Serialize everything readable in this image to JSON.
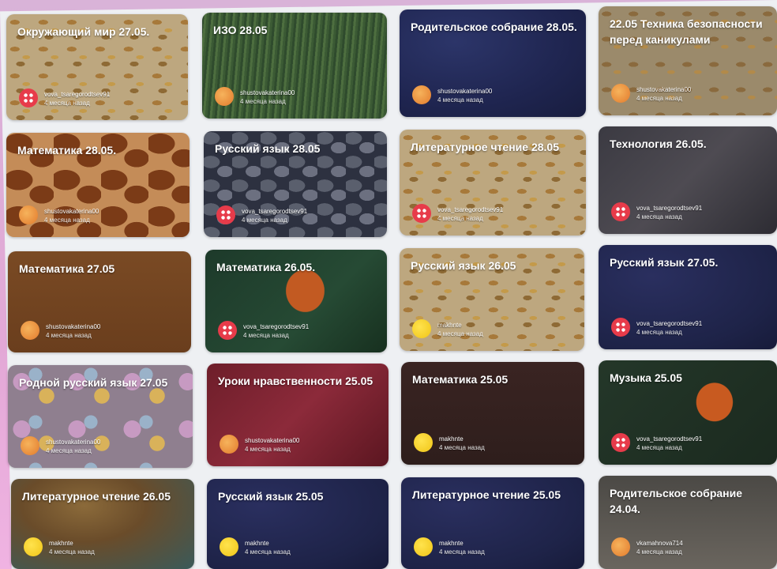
{
  "cards": [
    {
      "title": "Окружающий мир 27.05.",
      "user": "vova_tsaregorodtsev91",
      "time": "4 месяца назад",
      "avatar": "red"
    },
    {
      "title": "ИЗО 28.05",
      "user": "shustovakaterina00",
      "time": "4 месяца назад",
      "avatar": "orange"
    },
    {
      "title": "Родительское собрание 28.05.",
      "user": "shustovakaterina00",
      "time": "4 месяца назад",
      "avatar": "orange"
    },
    {
      "title": "22.05 Техника безопасности перед каникулами",
      "user": "shustovakaterina00",
      "time": "4 месяца назад",
      "avatar": "orange"
    },
    {
      "title": "Математика 28.05.",
      "user": "shustovakaterina00",
      "time": "4 месяца назад",
      "avatar": "orange"
    },
    {
      "title": "Русский язык 28.05",
      "user": "vova_tsaregorodtsev91",
      "time": "4 месяца назад",
      "avatar": "red"
    },
    {
      "title": "Литературное чтение 28.05",
      "user": "vova_tsaregorodtsev91",
      "time": "4 месяца назад",
      "avatar": "red"
    },
    {
      "title": "Технология 26.05.",
      "user": "vova_tsaregorodtsev91",
      "time": "4 месяца назад",
      "avatar": "red"
    },
    {
      "title": "Математика 27.05",
      "user": "shustovakaterina00",
      "time": "4 месяца назад",
      "avatar": "orange"
    },
    {
      "title": "Математика 26.05.",
      "user": "vova_tsaregorodtsev91",
      "time": "4 месяца назад",
      "avatar": "red"
    },
    {
      "title": "Русский язык 26.05",
      "user": "makhnte",
      "time": "4 месяца назад",
      "avatar": "yellow"
    },
    {
      "title": "Русский язык 27.05.",
      "user": "vova_tsaregorodtsev91",
      "time": "4 месяца назад",
      "avatar": "red"
    },
    {
      "title": "Родной русский язык 27.05",
      "user": "shustovakaterina00",
      "time": "4 месяца назад",
      "avatar": "orange"
    },
    {
      "title": "Уроки нравственности 25.05",
      "user": "shustovakaterina00",
      "time": "4 месяца назад",
      "avatar": "orange"
    },
    {
      "title": "Математика 25.05",
      "user": "makhnte",
      "time": "4 месяца назад",
      "avatar": "yellow"
    },
    {
      "title": "Музыка 25.05",
      "user": "vova_tsaregorodtsev91",
      "time": "4 месяца назад",
      "avatar": "red"
    },
    {
      "title": "Литературное чтение 26.05",
      "user": "makhnte",
      "time": "4 месяца назад",
      "avatar": "yellow"
    },
    {
      "title": "Русский язык 25.05",
      "user": "makhnte",
      "time": "4 месяца назад",
      "avatar": "yellow"
    },
    {
      "title": "Литературное чтение 25.05",
      "user": "makhnte",
      "time": "4 месяца назад",
      "avatar": "yellow"
    },
    {
      "title": "Родительское собрание 24.04.",
      "user": "vkamahnova714",
      "time": "4 месяца назад",
      "avatar": "orange"
    }
  ]
}
